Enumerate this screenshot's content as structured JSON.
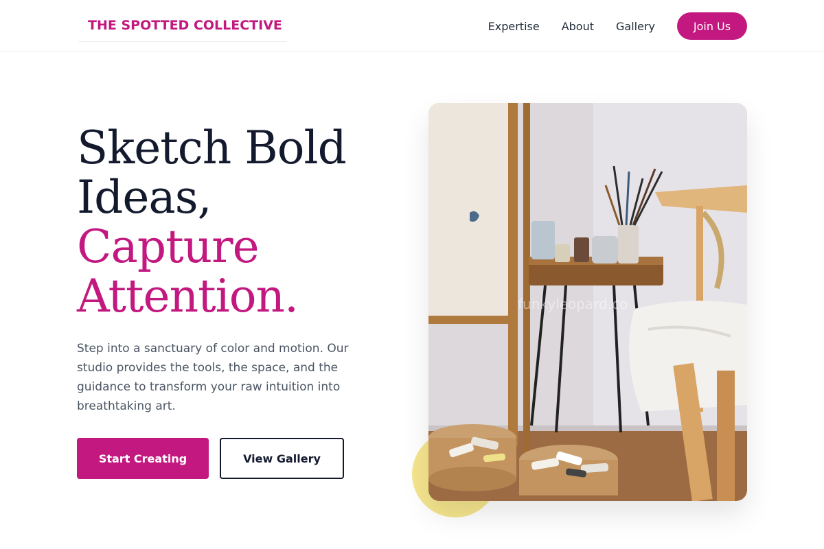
{
  "header": {
    "logo": "THE SPOTTED COLLECTIVE",
    "nav": [
      "Expertise",
      "About",
      "Gallery"
    ],
    "cta": "Join Us"
  },
  "hero": {
    "title_line1": "Sketch Bold",
    "title_line2": "Ideas,",
    "title_line3": "Capture",
    "title_line4": "Attention.",
    "description": "Step into a sanctuary of color and motion. Our studio provides the tools, the space, and the guidance to transform your raw intuition into breathtaking art.",
    "primary_button": "Start Creating",
    "secondary_button": "View Gallery"
  },
  "image": {
    "watermark": "funkyleopard.co"
  },
  "colors": {
    "accent": "#c2187f",
    "dark": "#141a2e",
    "yellow": "#f3e07a"
  }
}
